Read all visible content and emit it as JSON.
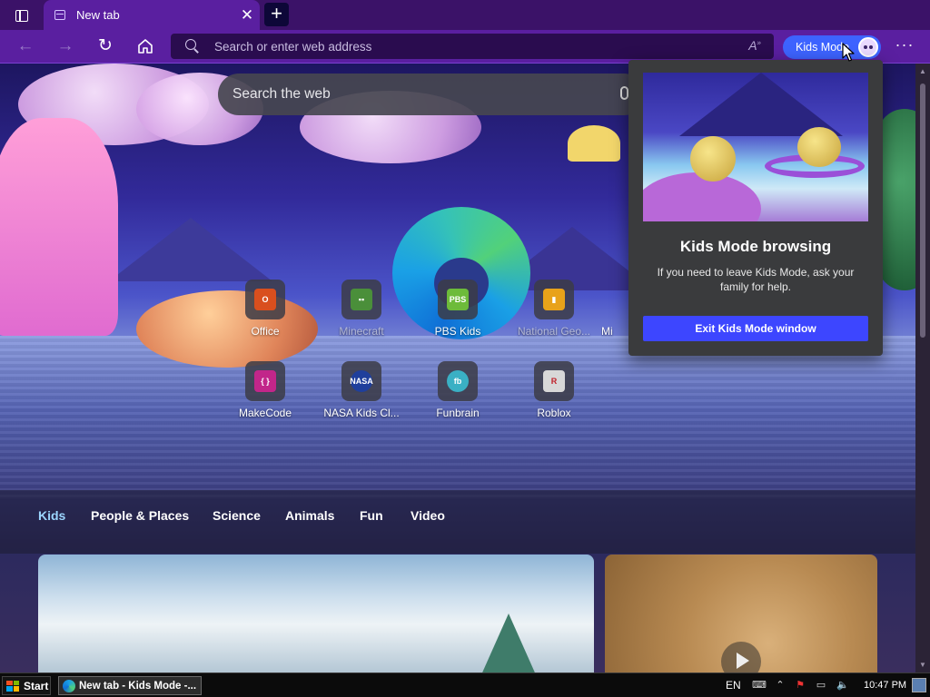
{
  "browser": {
    "tab": {
      "title": "New tab"
    },
    "address_bar": {
      "placeholder": "Search or enter web address"
    },
    "kids_mode_button": {
      "label": "Kids Mode"
    }
  },
  "page": {
    "web_search": {
      "placeholder": "Search the web"
    },
    "quick_links": [
      {
        "label": "Office",
        "color": "#d94f1e",
        "icon": "office-icon"
      },
      {
        "label": "Minecraft",
        "color": "#4a8f3a",
        "icon": "minecraft-icon"
      },
      {
        "label": "PBS Kids",
        "color": "#6dbb3a",
        "icon": "pbs-kids-icon"
      },
      {
        "label": "National Geo...",
        "color": "#e8a21a",
        "icon": "national-geographic-icon"
      },
      {
        "label": "Mi",
        "color": "#555555",
        "icon": "partial-tile-icon"
      },
      {
        "label": "MakeCode",
        "color": "#c2268a",
        "icon": "makecode-icon"
      },
      {
        "label": "NASA Kids Cl...",
        "color": "#1f3f9c",
        "icon": "nasa-icon"
      },
      {
        "label": "Funbrain",
        "color": "#3ab0c4",
        "icon": "funbrain-icon"
      },
      {
        "label": "Roblox",
        "color": "#d8d8d8",
        "icon": "roblox-icon"
      }
    ],
    "categories": [
      {
        "label": "Kids",
        "active": true
      },
      {
        "label": "People & Places",
        "active": false
      },
      {
        "label": "Science",
        "active": false
      },
      {
        "label": "Animals",
        "active": false
      },
      {
        "label": "Fun",
        "active": false
      },
      {
        "label": "Video",
        "active": false
      }
    ]
  },
  "flyout": {
    "title": "Kids Mode browsing",
    "body": "If you need to leave Kids Mode, ask your family for help.",
    "exit_button": "Exit Kids Mode window"
  },
  "taskbar": {
    "start_label": "Start",
    "task_item": "New tab - Kids Mode -...",
    "language": "EN",
    "clock": "10:47 PM"
  },
  "colors": {
    "titlebar": "#3b1268",
    "toolbar": "#5a1fa0",
    "kids_button": "#3d63ff",
    "exit_button": "#3d46ff",
    "flyout_bg": "#3a3b3d"
  }
}
